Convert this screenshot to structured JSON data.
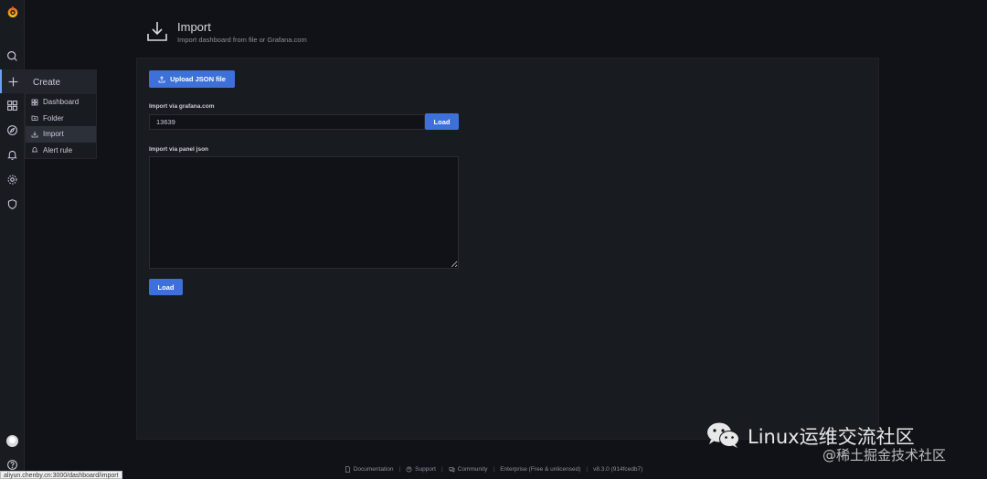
{
  "sidebar": {
    "logo": "grafana-logo-icon",
    "items": [
      {
        "name": "search",
        "icon": "search-icon"
      },
      {
        "name": "create",
        "icon": "plus-icon"
      },
      {
        "name": "dashboards",
        "icon": "grid-icon"
      },
      {
        "name": "explore",
        "icon": "compass-icon"
      },
      {
        "name": "alerting",
        "icon": "bell-icon"
      },
      {
        "name": "configuration",
        "icon": "gear-icon"
      },
      {
        "name": "server-admin",
        "icon": "shield-icon"
      },
      {
        "name": "help",
        "icon": "help-icon"
      }
    ]
  },
  "flyout": {
    "title": "Create",
    "items": [
      {
        "label": "Dashboard",
        "icon": "apps-icon"
      },
      {
        "label": "Folder",
        "icon": "folder-plus-icon"
      },
      {
        "label": "Import",
        "icon": "import-icon",
        "selected": true
      },
      {
        "label": "Alert rule",
        "icon": "bell-icon"
      }
    ]
  },
  "header": {
    "title": "Import",
    "subtitle": "Import dashboard from file or Grafana.com"
  },
  "form": {
    "upload_label": "Upload JSON file",
    "grafana_label": "Import via grafana.com",
    "grafana_value": "13639",
    "load_label": "Load",
    "panel_json_label": "Import via panel json",
    "load_main_label": "Load"
  },
  "footer": {
    "documentation": "Documentation",
    "support": "Support",
    "community": "Community",
    "enterprise": "Enterprise (Free & unlicensed)",
    "version": "v8.3.0 (914fcedb7)"
  },
  "status_url": "aliyun.chenby.cn:3000/dashboard/import",
  "watermark": {
    "main": "Linux运维交流社区",
    "secondary": "@稀土掘金技术社区"
  },
  "colors": {
    "accent": "#3d71d9",
    "background": "#111217",
    "panel": "#181b1f"
  }
}
